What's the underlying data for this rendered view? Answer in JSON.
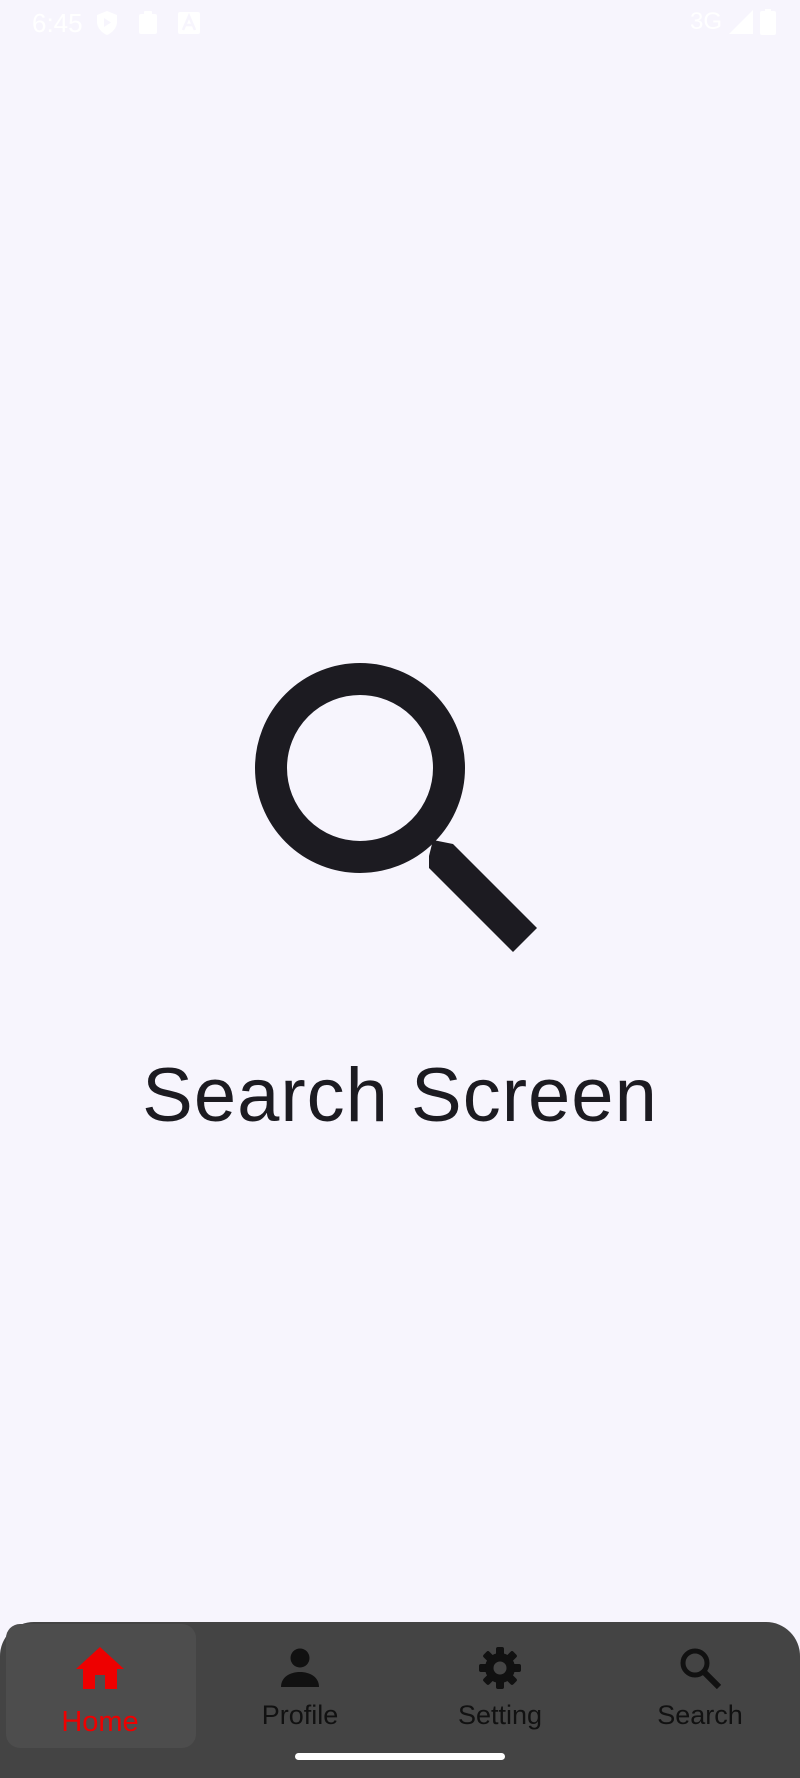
{
  "status_bar": {
    "time": "6:45",
    "network": "3G",
    "left_icons": [
      "shield-icon",
      "clipboard-icon",
      "font-icon"
    ],
    "right_icons": [
      "signal-icon",
      "battery-icon"
    ]
  },
  "main": {
    "icon": "search-icon",
    "title": "Search Screen"
  },
  "bottom_nav": {
    "items": [
      {
        "label": "Home",
        "icon": "home-icon",
        "active": true
      },
      {
        "label": "Profile",
        "icon": "person-icon",
        "active": false
      },
      {
        "label": "Setting",
        "icon": "gear-icon",
        "active": false
      },
      {
        "label": "Search",
        "icon": "search-icon",
        "active": false
      }
    ]
  },
  "colors": {
    "background": "#f7f5fd",
    "nav_background": "#444444",
    "active": "#ee0000",
    "text": "#1c1b21"
  }
}
